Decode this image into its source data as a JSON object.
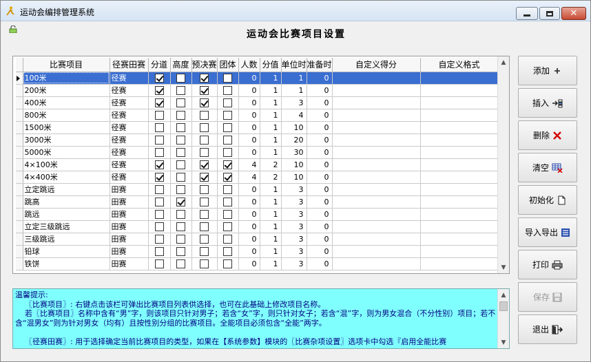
{
  "window": {
    "title": "运动会编排管理系统"
  },
  "page": {
    "title": "运动会比赛项目设置"
  },
  "grid": {
    "columns": [
      "比赛项目",
      "径赛田赛",
      "分道",
      "高度",
      "预决赛",
      "团体",
      "人数",
      "分值",
      "单位时",
      "准备时",
      "自定义得分",
      "自定义格式"
    ],
    "rows": [
      {
        "name": "100米",
        "type": "径赛",
        "lane": true,
        "height": false,
        "prelim": true,
        "team": false,
        "people": "0",
        "score": "1",
        "unit": "1",
        "prep": "0"
      },
      {
        "name": "200米",
        "type": "径赛",
        "lane": true,
        "height": false,
        "prelim": true,
        "team": false,
        "people": "0",
        "score": "1",
        "unit": "1",
        "prep": "0"
      },
      {
        "name": "400米",
        "type": "径赛",
        "lane": true,
        "height": false,
        "prelim": true,
        "team": false,
        "people": "0",
        "score": "1",
        "unit": "3",
        "prep": "0"
      },
      {
        "name": "800米",
        "type": "径赛",
        "lane": false,
        "height": false,
        "prelim": false,
        "team": false,
        "people": "0",
        "score": "1",
        "unit": "4",
        "prep": "0"
      },
      {
        "name": "1500米",
        "type": "径赛",
        "lane": false,
        "height": false,
        "prelim": false,
        "team": false,
        "people": "0",
        "score": "1",
        "unit": "10",
        "prep": "0"
      },
      {
        "name": "3000米",
        "type": "径赛",
        "lane": false,
        "height": false,
        "prelim": false,
        "team": false,
        "people": "0",
        "score": "1",
        "unit": "20",
        "prep": "0"
      },
      {
        "name": "5000米",
        "type": "径赛",
        "lane": false,
        "height": false,
        "prelim": false,
        "team": false,
        "people": "0",
        "score": "1",
        "unit": "30",
        "prep": "0"
      },
      {
        "name": "4×100米",
        "type": "径赛",
        "lane": true,
        "height": false,
        "prelim": true,
        "team": true,
        "people": "4",
        "score": "2",
        "unit": "10",
        "prep": "0"
      },
      {
        "name": "4×400米",
        "type": "径赛",
        "lane": true,
        "height": false,
        "prelim": true,
        "team": true,
        "people": "4",
        "score": "2",
        "unit": "10",
        "prep": "0"
      },
      {
        "name": "立定跳远",
        "type": "田赛",
        "lane": false,
        "height": false,
        "prelim": false,
        "team": false,
        "people": "0",
        "score": "1",
        "unit": "3",
        "prep": "0"
      },
      {
        "name": "跳高",
        "type": "田赛",
        "lane": false,
        "height": true,
        "prelim": false,
        "team": false,
        "people": "0",
        "score": "1",
        "unit": "3",
        "prep": "0"
      },
      {
        "name": "跳远",
        "type": "田赛",
        "lane": false,
        "height": false,
        "prelim": false,
        "team": false,
        "people": "0",
        "score": "1",
        "unit": "3",
        "prep": "0"
      },
      {
        "name": "立定三级跳远",
        "type": "田赛",
        "lane": false,
        "height": false,
        "prelim": false,
        "team": false,
        "people": "0",
        "score": "1",
        "unit": "3",
        "prep": "0"
      },
      {
        "name": "三级跳远",
        "type": "田赛",
        "lane": false,
        "height": false,
        "prelim": false,
        "team": false,
        "people": "0",
        "score": "1",
        "unit": "3",
        "prep": "0"
      },
      {
        "name": "铅球",
        "type": "田赛",
        "lane": false,
        "height": false,
        "prelim": false,
        "team": false,
        "people": "0",
        "score": "1",
        "unit": "3",
        "prep": "0"
      },
      {
        "name": "铁饼",
        "type": "田赛",
        "lane": false,
        "height": false,
        "prelim": false,
        "team": false,
        "people": "0",
        "score": "1",
        "unit": "3",
        "prep": "0"
      }
    ]
  },
  "hint": {
    "text": "温馨提示:\n    〖比赛项目〗: 右键点击该栏可弹出比赛项目列表供选择，也可在此基础上修改项目名称。\n    若〖比赛项目〗名称中含有“男”字，则该项目只针对男子；若含“女”字，则只针对女子；若含“混”字，则为男女混合（不分性别）项目；若不含“混男女”则为针对男女（均有）且按性别分组的比赛项目。全能项目必须包含“全能”两字。\n\n    〖径赛田赛〗: 用于选择确定当前比赛项目的类型，如果在【系统参数】模块的〖比赛杂项设置〗选项卡中勾选『启用全能比赛"
  },
  "buttons": {
    "add": "添加",
    "insert": "插入",
    "delete": "删除",
    "clear": "清空",
    "init": "初始化",
    "import_export": "导入导出",
    "print": "打印",
    "save": "保存",
    "exit": "退出"
  },
  "colors": {
    "selection": "#3a6ed1",
    "hint_bg": "#80ffff",
    "hint_text": "#000080",
    "delete_icon": "#d40000"
  }
}
